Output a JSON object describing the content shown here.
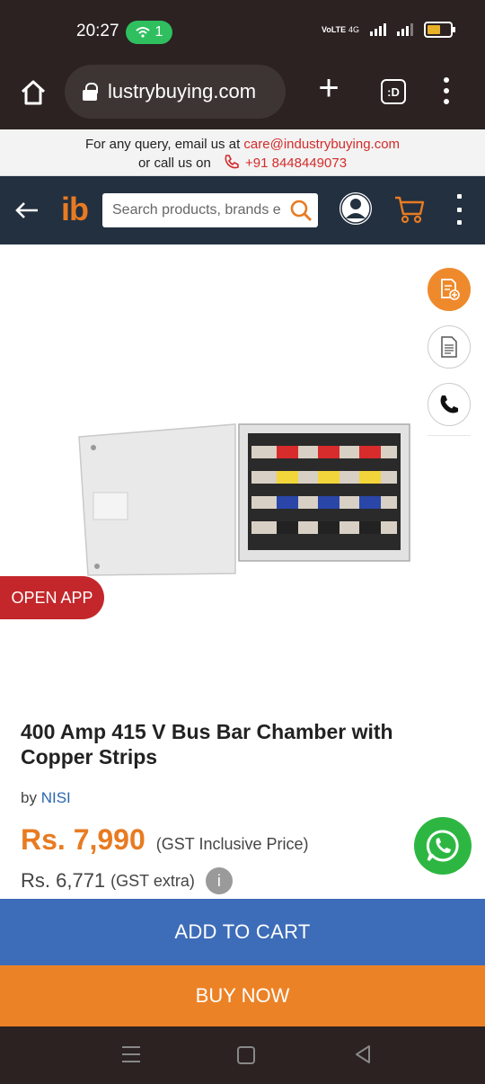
{
  "status": {
    "time": "20:27",
    "wifi_count": "1",
    "volte_label": "VoLTE",
    "network": "4G"
  },
  "browser": {
    "url": "lustrybuying.com",
    "tab_label": ":D"
  },
  "query_bar": {
    "line1_prefix": "For any query, email us at ",
    "email": "care@industrybuying.com",
    "line2_prefix": "or call us on",
    "phone": "+91 8448449073"
  },
  "header": {
    "logo_i": "i",
    "logo_b": "b",
    "search_placeholder": "Search products, brands e"
  },
  "product": {
    "open_app_label": "OPEN APP",
    "title": "400 Amp 415 V Bus Bar Chamber with Copper Strips",
    "brand_prefix": "by ",
    "brand": "NISI",
    "price": "Rs. 7,990",
    "price_note": "(GST Inclusive Price)",
    "price_ex": "Rs. 6,771",
    "price_ex_note": "(GST extra)",
    "info_label": "i"
  },
  "actions": {
    "add_to_cart": "ADD TO CART",
    "buy_now": "BUY NOW"
  },
  "icons": {
    "side": [
      "quote-icon",
      "document-icon",
      "phone-icon"
    ],
    "accent": "#e87b22",
    "primary_blue": "#3d6cb9"
  }
}
